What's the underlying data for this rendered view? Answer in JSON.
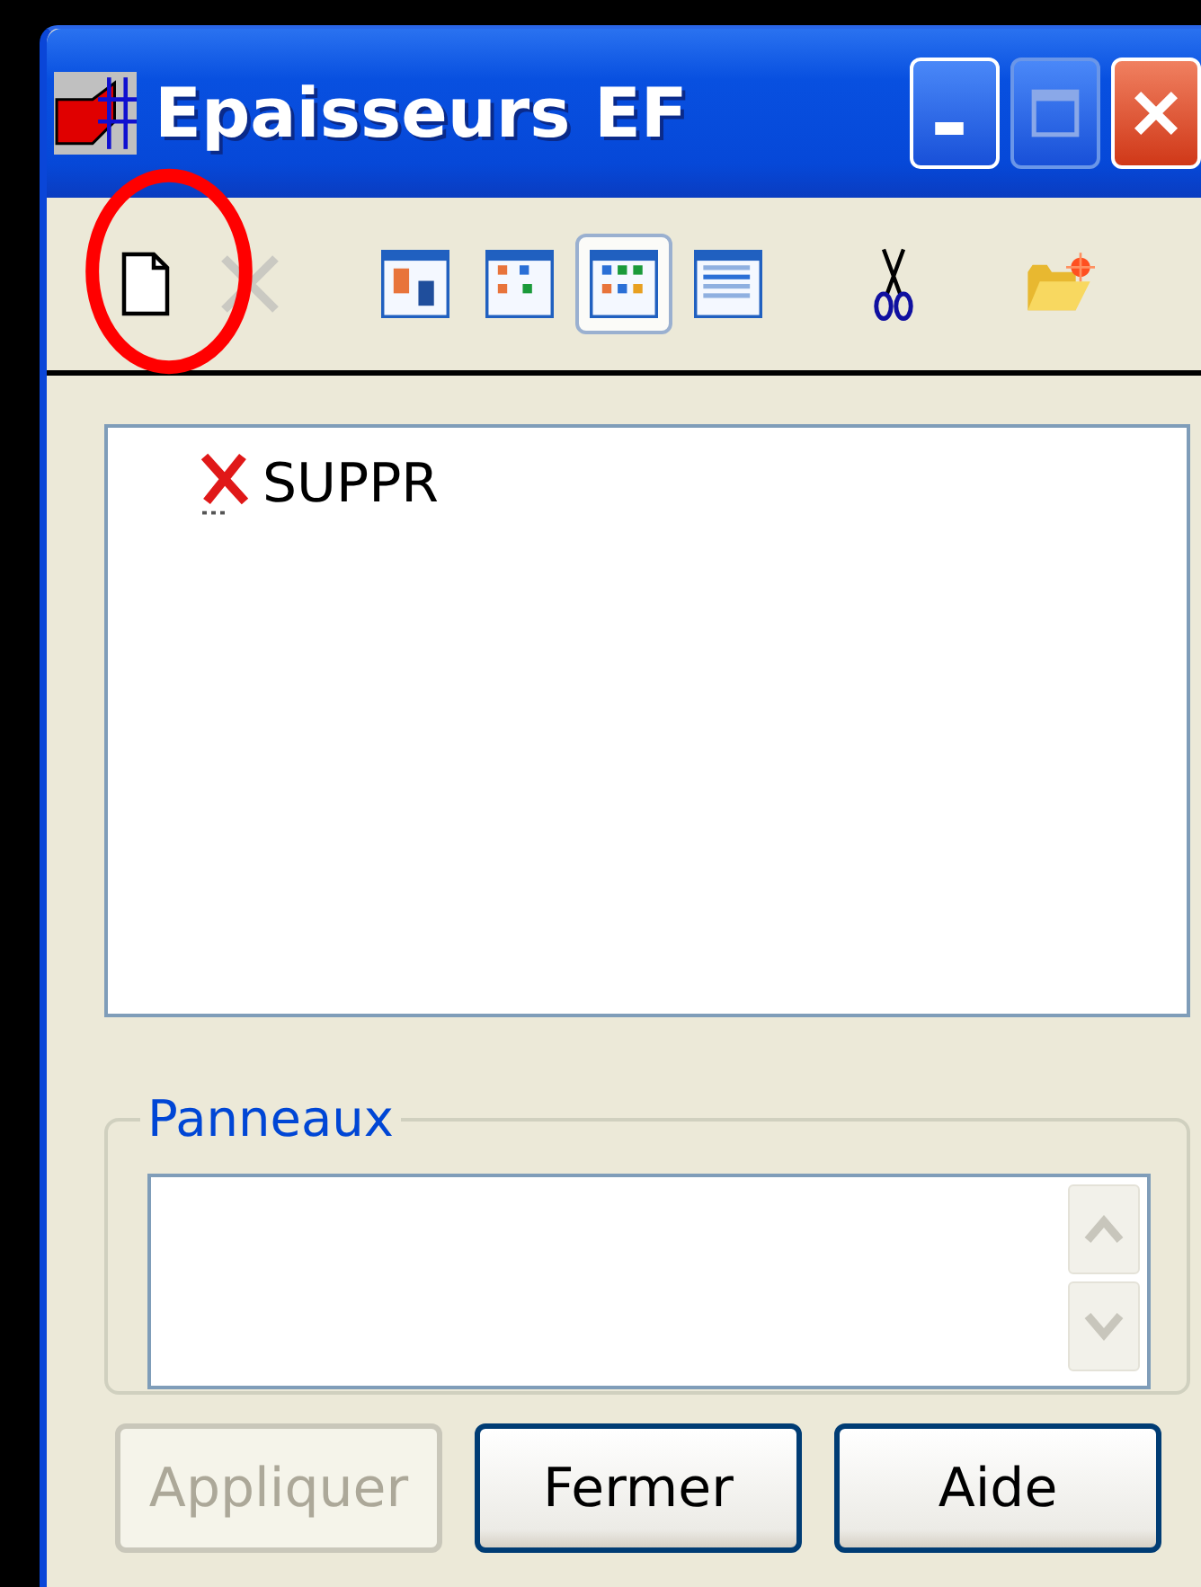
{
  "window": {
    "title": "Epaisseurs EF"
  },
  "toolbar": [
    {
      "kind": "new",
      "disabled": false,
      "selected": false
    },
    {
      "kind": "delete",
      "disabled": true,
      "selected": false
    },
    {
      "kind": "view-large",
      "disabled": false,
      "selected": false
    },
    {
      "kind": "view-small",
      "disabled": false,
      "selected": false
    },
    {
      "kind": "view-list",
      "disabled": false,
      "selected": true
    },
    {
      "kind": "view-details",
      "disabled": false,
      "selected": false
    },
    {
      "kind": "cut",
      "disabled": false,
      "selected": false
    },
    {
      "kind": "folder",
      "disabled": false,
      "selected": false
    }
  ],
  "items": [
    {
      "label": "SUPPR",
      "kind": "deleted"
    }
  ],
  "panneaux": {
    "legend": "Panneaux"
  },
  "buttons": [
    {
      "label": "Appliquer",
      "disabled": true
    },
    {
      "label": "Fermer",
      "disabled": false
    },
    {
      "label": "Aide",
      "disabled": false
    }
  ]
}
